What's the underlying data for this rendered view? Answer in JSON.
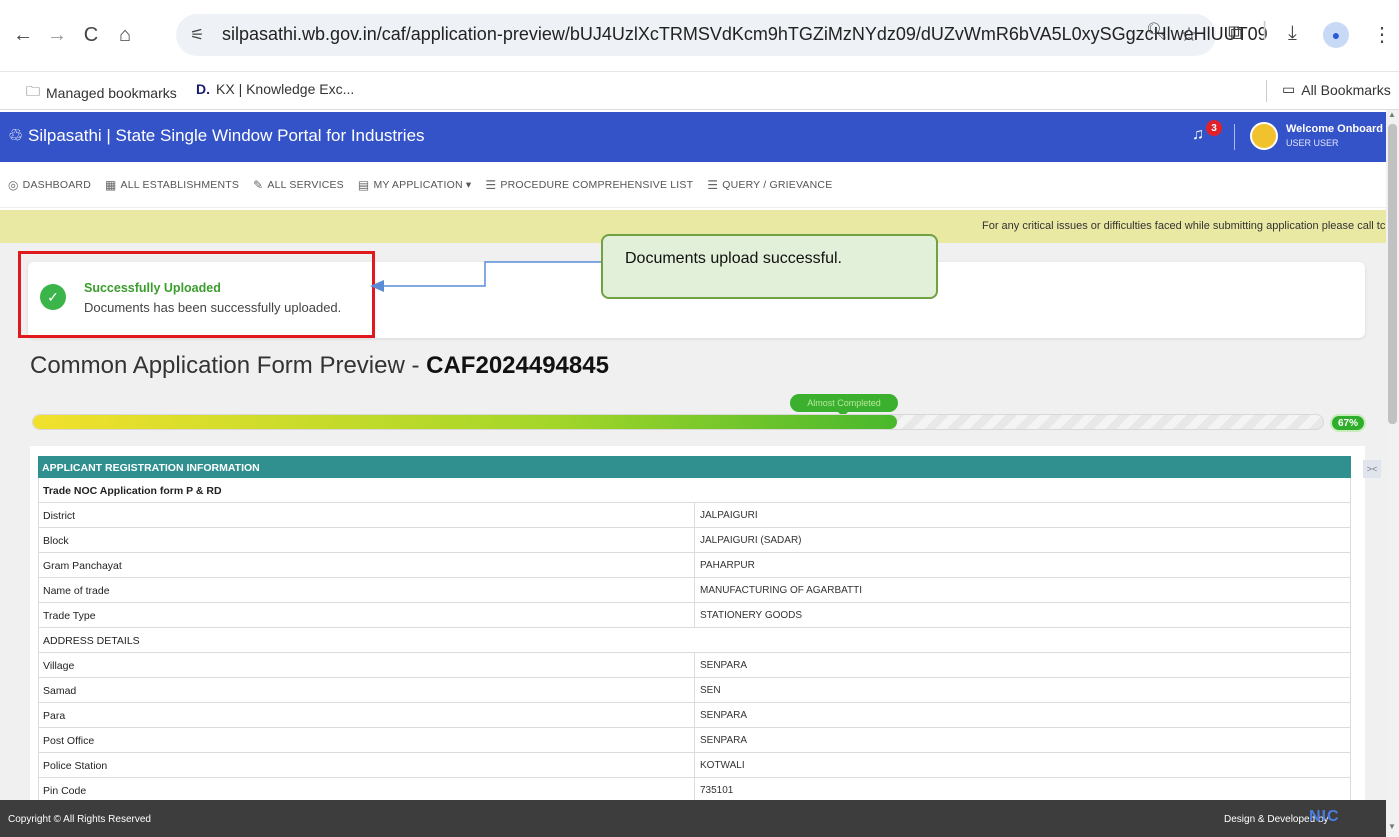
{
  "browser": {
    "url": "silpasathi.wb.gov.in/caf/application-preview/bUJ4UzlXcTRMSVdKcm9hTGZiMzNYdz09/dUZvWmR6bVA5L0xySGgzcHlweHlUUT09",
    "back_icon": "←",
    "forward_icon": "→",
    "reload_icon": "C",
    "home_icon": "⌂",
    "tune_icon": "⚟",
    "zoom_icon": "🔍︎",
    "star_icon": "☆",
    "extensions_icon": "⧉",
    "download_icon": "⤓",
    "profile_icon": "●",
    "menu_icon": "⋮"
  },
  "bookmarks": {
    "managed_icon": "🗀",
    "managed": "Managed bookmarks",
    "kx_icon": "D.",
    "kx": "KX | Knowledge Exc...",
    "all_icon": "▭",
    "all": "All Bookmarks"
  },
  "header": {
    "logo_icon": "♲",
    "title": "Silpasathi | State Single Window Portal for Industries",
    "bell_icon": "♫",
    "notification_count": "3",
    "welcome": "Welcome Onboard",
    "caret": "▾",
    "user": "USER USER"
  },
  "nav": [
    {
      "icon": "◎",
      "label": "DASHBOARD"
    },
    {
      "icon": "▦",
      "label": "ALL ESTABLISHMENTS"
    },
    {
      "icon": "✎",
      "label": "ALL SERVICES"
    },
    {
      "icon": "▤",
      "label": "MY APPLICATION ▾"
    },
    {
      "icon": "☰",
      "label": "PROCEDURE COMPREHENSIVE LIST"
    },
    {
      "icon": "☰",
      "label": "QUERY / GRIEVANCE"
    }
  ],
  "marquee": "For any critical issues or difficulties faced while submitting application please call tc",
  "success": {
    "check": "✓",
    "title": "Successfully Uploaded",
    "message": "Documents has been successfully uploaded."
  },
  "callout": "Documents upload successful.",
  "heading": {
    "prefix": "Common Application Form Preview - ",
    "caf_number": "CAF2024494845"
  },
  "progress": {
    "tip": "Almost Completed",
    "percent_label": "67%",
    "percent": 67
  },
  "table": {
    "header": "APPLICANT REGISTRATION INFORMATION",
    "rows": [
      {
        "label": "Trade NOC Application form P & RD",
        "value": "",
        "section": true
      },
      {
        "label": "District",
        "value": "JALPAIGURI"
      },
      {
        "label": "Block",
        "value": "JALPAIGURI (SADAR)"
      },
      {
        "label": "Gram Panchayat",
        "value": "PAHARPUR"
      },
      {
        "label": "Name of trade",
        "value": "MANUFACTURING OF AGARBATTI"
      },
      {
        "label": "Trade Type",
        "value": "STATIONERY GOODS"
      },
      {
        "label": "ADDRESS DETAILS",
        "value": "",
        "section": false
      },
      {
        "label": "Village",
        "value": "SENPARA"
      },
      {
        "label": "Samad",
        "value": "SEN"
      },
      {
        "label": "Para",
        "value": "SENPARA"
      },
      {
        "label": "Post Office",
        "value": "SENPARA"
      },
      {
        "label": "Police Station",
        "value": "KOTWALI"
      },
      {
        "label": "Pin Code",
        "value": "735101"
      }
    ]
  },
  "footer": {
    "copyright": "Copyright © All Rights Reserved",
    "credit": "Design & Developed by",
    "nic": "NIC"
  },
  "colors": {
    "header_blue": "#3553c8",
    "table_header_teal": "#309090",
    "success_green": "#3bb54a",
    "highlight_red": "#e0191f"
  }
}
